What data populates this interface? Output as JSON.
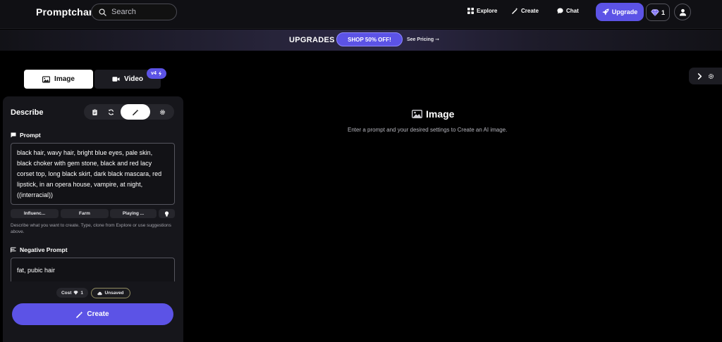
{
  "nav": {
    "logo": "Promptchan",
    "search_placeholder": "Search",
    "links": [
      {
        "label": "Explore",
        "icon": "grid-icon"
      },
      {
        "label": "Create",
        "icon": "magic-wand-icon"
      },
      {
        "label": "Chat",
        "icon": "chat-bubble-icon"
      }
    ],
    "upgrade_label": "Upgrade",
    "gems_count": "1"
  },
  "banner": {
    "title": "UPGRADES",
    "shop_label": "SHOP 50% OFF!",
    "see_pricing": "See Pricing ➞"
  },
  "mode_tabs": {
    "image_label": "Image",
    "video_label": "Video",
    "video_badge": "v4"
  },
  "panel": {
    "title": "Describe",
    "prompt_label": "Prompt",
    "prompt_value": "black hair, wavy hair, bright blue eyes, pale skin, black choker with gem stone, black and red lacy corset top, long black skirt, dark black mascara, red lipstick, in an opera house, vampire, at night, ((interracial))",
    "chips": [
      "Influenc...",
      "Farm",
      "Playing ..."
    ],
    "helper_text": "Describe what you want to create. Type, clone from Explore or use suggestions above.",
    "negative_label": "Negative Prompt",
    "negative_value": "fat, pubic hair",
    "cost_label": "Cost",
    "cost_value": "1",
    "unsaved_label": "Unsaved",
    "create_label": "Create"
  },
  "main": {
    "title": "Image",
    "subtitle": "Enter a prompt and your desired settings to Create an AI image."
  },
  "colors": {
    "accent": "#5c53e6",
    "background": "#000000",
    "panel": "#16161b"
  }
}
